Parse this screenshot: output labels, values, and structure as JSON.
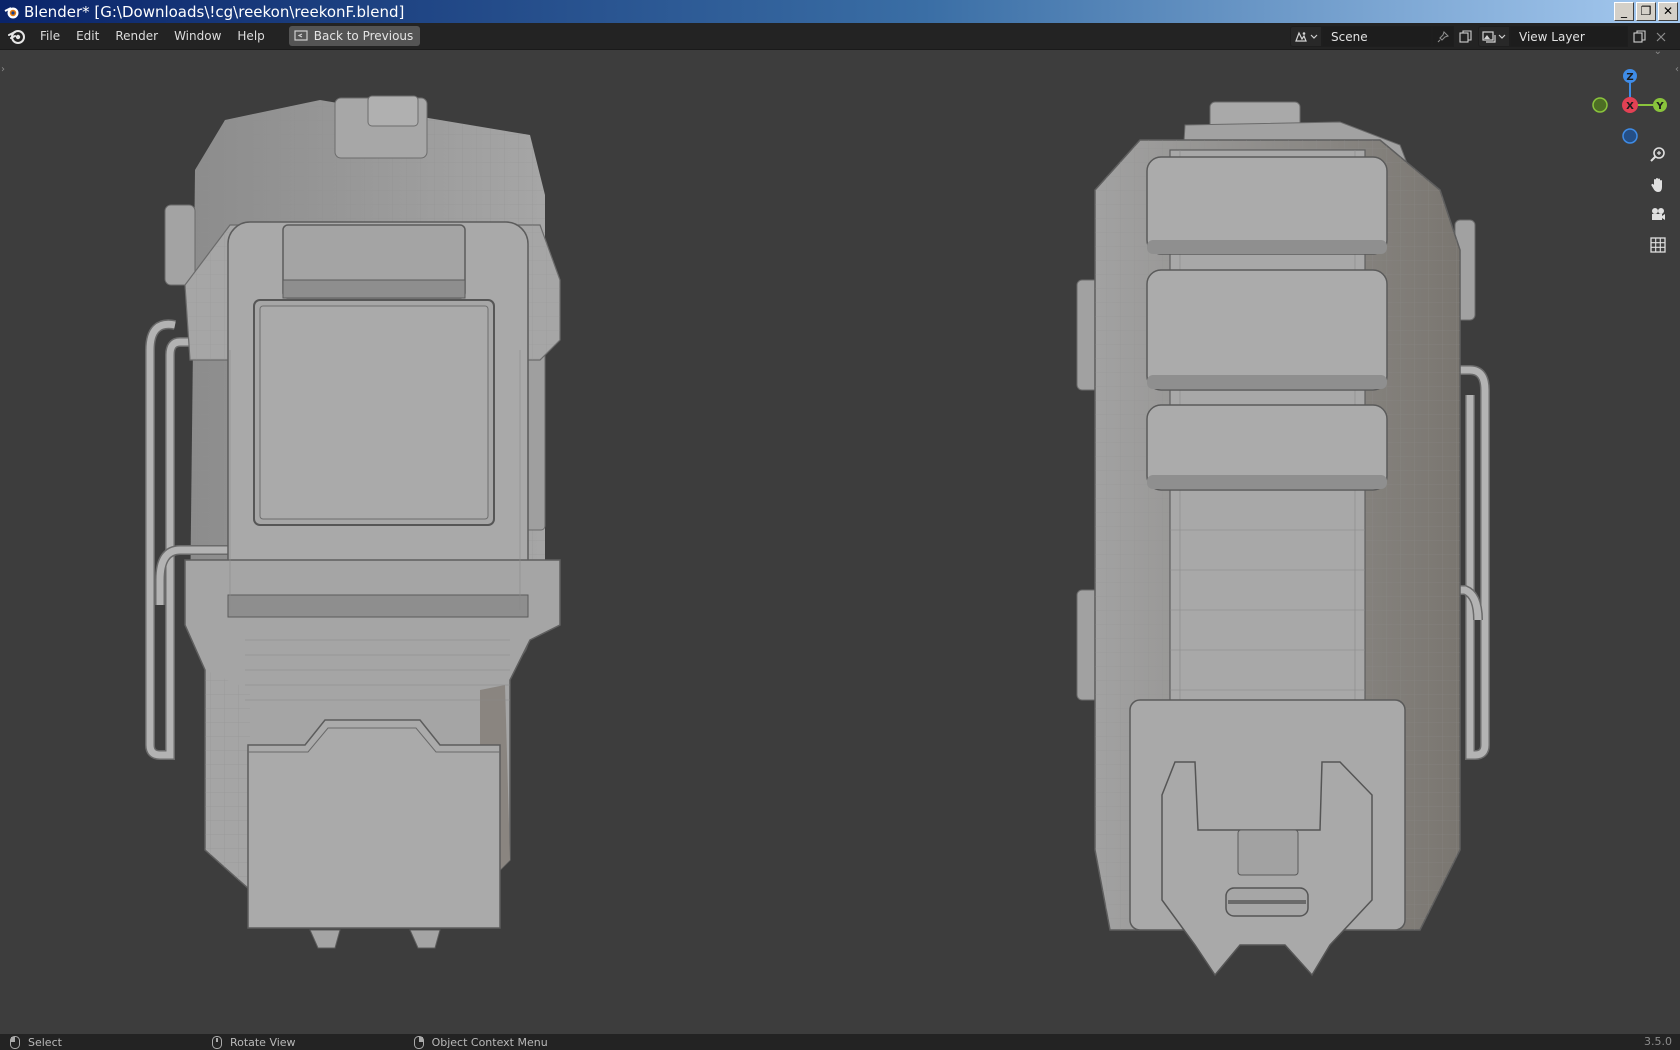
{
  "window": {
    "title": "Blender* [G:\\Downloads\\!cg\\reekon\\reekonF.blend]",
    "controls": {
      "minimize": "_",
      "restore": "❐",
      "close": "✕"
    }
  },
  "menu": {
    "items": [
      {
        "label": "File"
      },
      {
        "label": "Edit"
      },
      {
        "label": "Render"
      },
      {
        "label": "Window"
      },
      {
        "label": "Help"
      }
    ],
    "back_button": "Back to Previous"
  },
  "scene": {
    "name": "Scene"
  },
  "view_layer": {
    "name": "View Layer"
  },
  "gizmo": {
    "z": "Z",
    "x": "X",
    "y": "Y"
  },
  "nav_icons": [
    "zoom-icon",
    "hand-pan-icon",
    "camera-icon",
    "grid-icon"
  ],
  "status": {
    "select": "Select",
    "rotate": "Rotate View",
    "context": "Object Context Menu",
    "version": "3.5.0"
  },
  "colors": {
    "axis_x": "#e34154",
    "axis_y": "#8ac43c",
    "axis_z": "#3f8ce7",
    "viewport_bg": "#3d3d3d",
    "model": "#a9a9a9"
  }
}
